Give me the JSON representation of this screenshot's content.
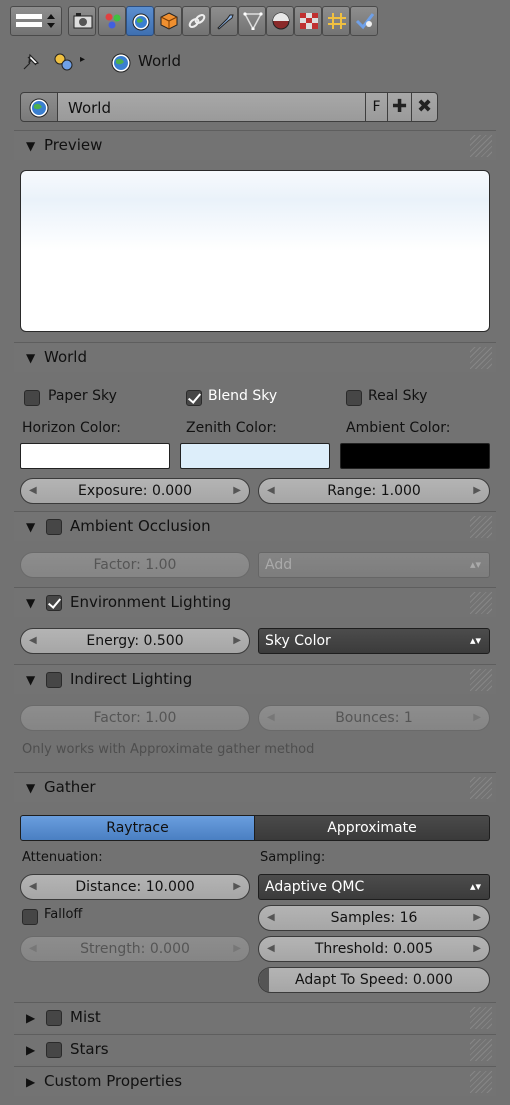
{
  "toolbar": {
    "icons": [
      "editor-type-icon",
      "render-icon",
      "render-layers-icon",
      "scene-icon",
      "world-icon",
      "object-icon",
      "constraints-icon",
      "modifiers-icon",
      "data-icon",
      "material-icon",
      "texture-icon",
      "particles-icon",
      "physics-icon"
    ],
    "active": "world-icon"
  },
  "breadcrumb": {
    "label": "World"
  },
  "datablock": {
    "name": "World",
    "fake_user": "F"
  },
  "preview": {
    "title": "Preview"
  },
  "world": {
    "title": "World",
    "paper_sky": "Paper Sky",
    "blend_sky": "Blend Sky",
    "real_sky": "Real Sky",
    "paper_sky_checked": false,
    "blend_sky_checked": true,
    "real_sky_checked": false,
    "horizon_label": "Horizon Color:",
    "zenith_label": "Zenith Color:",
    "ambient_label": "Ambient Color:",
    "horizon_color": "#ffffff",
    "zenith_color": "#ddeefa",
    "ambient_color": "#000000",
    "exposure": "Exposure: 0.000",
    "range": "Range: 1.000"
  },
  "ao": {
    "title": "Ambient Occlusion",
    "enabled": false,
    "factor": "Factor: 1.00",
    "blend": "Add"
  },
  "env": {
    "title": "Environment Lighting",
    "enabled": true,
    "energy": "Energy: 0.500",
    "source": "Sky Color"
  },
  "indirect": {
    "title": "Indirect Lighting",
    "enabled": false,
    "factor": "Factor: 1.00",
    "bounces": "Bounces: 1",
    "note": "Only works with Approximate gather method"
  },
  "gather": {
    "title": "Gather",
    "raytrace": "Raytrace",
    "approximate": "Approximate",
    "attenuation_label": "Attenuation:",
    "sampling_label": "Sampling:",
    "distance": "Distance: 10.000",
    "sampling_method": "Adaptive QMC",
    "falloff": "Falloff",
    "falloff_checked": false,
    "samples": "Samples: 16",
    "strength": "Strength: 0.000",
    "threshold": "Threshold: 0.005",
    "adapt": "Adapt To Speed: 0.000",
    "adapt_value": 0.0
  },
  "mist": {
    "title": "Mist",
    "enabled": false
  },
  "stars": {
    "title": "Stars",
    "enabled": false
  },
  "custom": {
    "title": "Custom Properties"
  }
}
